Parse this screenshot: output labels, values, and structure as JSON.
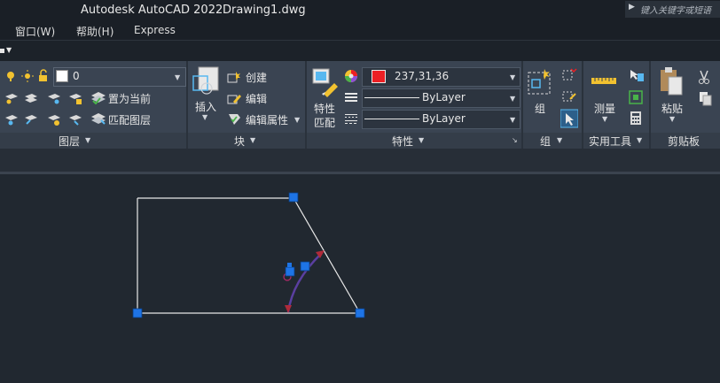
{
  "window": {
    "app_title": "Autodesk AutoCAD 2022",
    "file_title": "Drawing1.dwg",
    "search_placeholder": "键入关键字或短语"
  },
  "menu": {
    "items": [
      "窗口(W)",
      "帮助(H)",
      "Express"
    ]
  },
  "ribbon": {
    "layers": {
      "current_layer": "0",
      "set_current": "置为当前",
      "match_layer": "匹配图层",
      "footer": "图层"
    },
    "block": {
      "insert": "插入",
      "create": "创建",
      "edit": "编辑",
      "edit_attributes": "编辑属性",
      "footer": "块"
    },
    "properties": {
      "match_line1": "特性",
      "match_line2": "匹配",
      "color_value": "237,31,36",
      "color_swatch": "#ed1f24",
      "linetype": "ByLayer",
      "lineweight": "ByLayer",
      "footer": "特性"
    },
    "groups": {
      "group": "组",
      "footer": "组"
    },
    "utilities": {
      "measure": "测量",
      "footer": "实用工具"
    },
    "clipboard": {
      "paste": "粘贴",
      "footer": "剪贴板"
    }
  },
  "colors": {
    "background": "#212830",
    "ribbon": "#3a4452",
    "grip": "#1e74e6",
    "geometry": "#e8e8e8",
    "dimension_arc": "#5a3fa0"
  }
}
